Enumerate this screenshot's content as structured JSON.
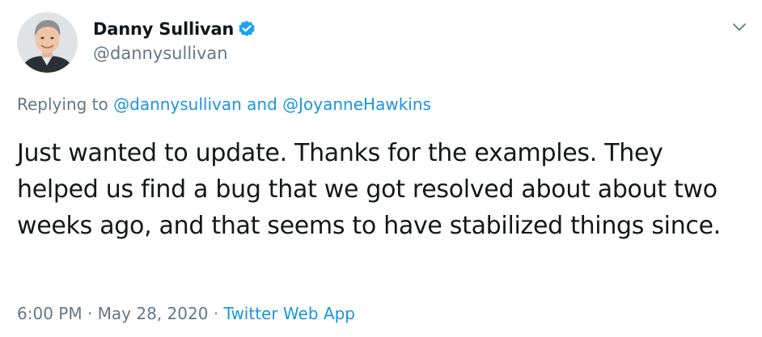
{
  "author": {
    "display_name": "Danny Sullivan",
    "handle": "@dannysullivan",
    "verified_icon": "verified-badge-icon",
    "avatar": "avatar"
  },
  "menu": {
    "caret_icon": "chevron-down-icon"
  },
  "reply": {
    "prefix": "Replying to",
    "user1": "@dannysullivan",
    "conjunction": "and",
    "user2": "@JoyanneHawkins"
  },
  "tweet": {
    "text": "Just wanted to update. Thanks for the examples. They helped us find a bug that we got resolved about about two weeks ago, and that seems to have stabilized things since."
  },
  "meta": {
    "time": "6:00 PM",
    "sep1": "·",
    "date": "May 28, 2020",
    "sep2": "·",
    "app": "Twitter Web App"
  },
  "colors": {
    "link": "#1b95e0",
    "secondary_text": "#657786",
    "primary_text": "#14171a",
    "verified": "#1da1f2"
  }
}
